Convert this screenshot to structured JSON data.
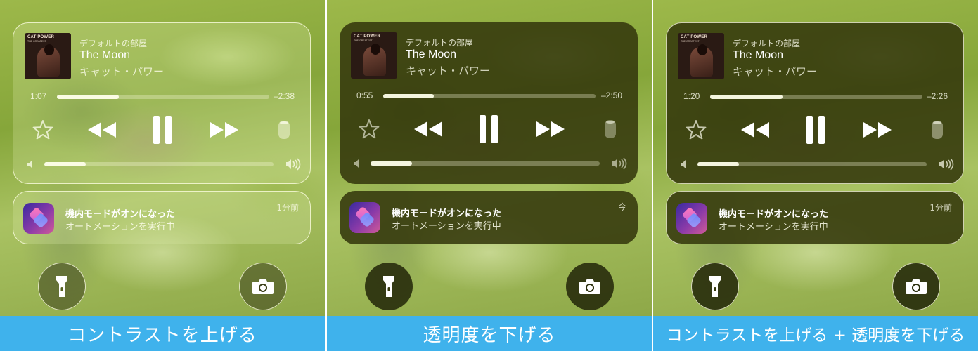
{
  "panels": [
    {
      "key": "contrast",
      "caption": "コントラストを上げる",
      "player": {
        "source": "デフォルトの部屋",
        "song": "The Moon",
        "artist": "キャット・パワー",
        "elapsed": "1:07",
        "remaining": "–2:38",
        "progress": 0.29,
        "volume": 0.18
      },
      "notification": {
        "title": "機内モードがオンになった",
        "body": "オートメーションを実行中",
        "time": "1分前"
      }
    },
    {
      "key": "reduce",
      "caption": "透明度を下げる",
      "player": {
        "source": "デフォルトの部屋",
        "song": "The Moon",
        "artist": "キャット・パワー",
        "elapsed": "0:55",
        "remaining": "–2:50",
        "progress": 0.24,
        "volume": 0.18
      },
      "notification": {
        "title": "機内モードがオンになった",
        "body": "オートメーションを実行中",
        "time": "今"
      }
    },
    {
      "key": "both",
      "caption": "コントラストを上げる + 透明度を下げる",
      "player": {
        "source": "デフォルトの部屋",
        "song": "The Moon",
        "artist": "キャット・パワー",
        "elapsed": "1:20",
        "remaining": "–2:26",
        "progress": 0.34,
        "volume": 0.18
      },
      "notification": {
        "title": "機内モードがオンになった",
        "body": "オートメーションを実行中",
        "time": "1分前"
      }
    }
  ],
  "album_art": {
    "line1": "CAT POWER",
    "line2": "THE GREATEST"
  },
  "icons": [
    "star-icon",
    "rewind-icon",
    "pause-icon",
    "fast-forward-icon",
    "homepod-icon",
    "volume-low-icon",
    "volume-high-icon",
    "shortcuts-app-icon",
    "flashlight-icon",
    "camera-icon"
  ],
  "colors": {
    "caption_bg": "#3fb2ec",
    "reduced_card_bg": "#34380c",
    "background_green": "#8ea848"
  }
}
